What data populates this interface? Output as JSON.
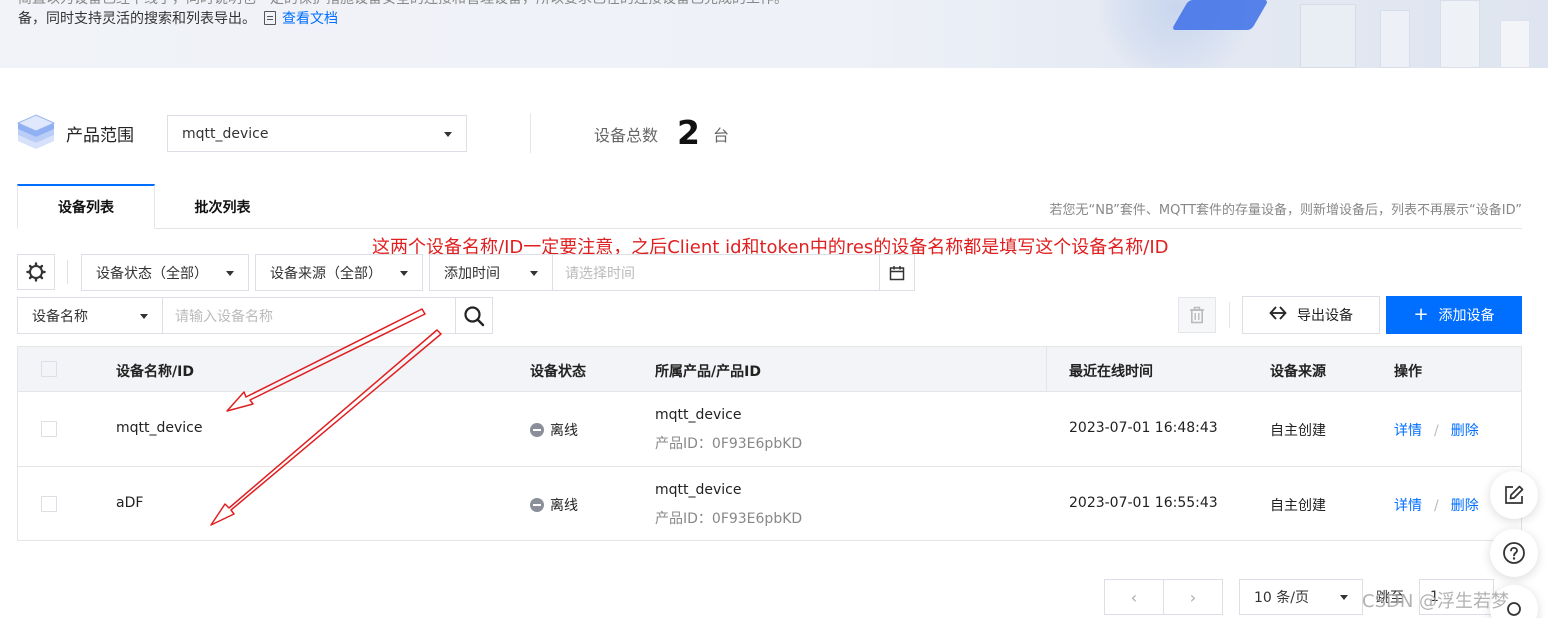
{
  "banner": {
    "cut_text": "简直以为设备已经下线了，同时说明也一定的保护措施设备安全的连接和管理设备，所以要求已在的连接设备已完成的工作。",
    "text": "备，同时支持灵活的搜索和列表导出。",
    "doc_link": "查看文档"
  },
  "product": {
    "label": "产品范围",
    "selected": "mqtt_device"
  },
  "summary": {
    "label": "设备总数",
    "count": "2",
    "unit": "台"
  },
  "tabs": [
    {
      "label": "设备列表",
      "active": true
    },
    {
      "label": "批次列表",
      "active": false
    }
  ],
  "tabs_hint": "若您无“NB”套件、MQTT套件的存量设备，则新增设备后，列表不再展示“设备ID”",
  "annotation": "这两个设备名称/ID一定要注意，之后Client id和token中的res的设备名称都是填写这个设备名称/ID",
  "filters": {
    "status": "设备状态（全部）",
    "source": "设备来源（全部）",
    "time_type": "添加时间",
    "time_placeholder": "请选择时间",
    "search_field": "设备名称",
    "search_placeholder": "请输入设备名称"
  },
  "actions": {
    "export": "导出设备",
    "add": "添加设备"
  },
  "table": {
    "headers": [
      "设备名称/ID",
      "设备状态",
      "所属产品/产品ID",
      "最近在线时间",
      "设备来源",
      "操作"
    ],
    "rows": [
      {
        "name": "mqtt_device",
        "status": "离线",
        "product": "mqtt_device",
        "product_id": "产品ID：0F93E6pbKD",
        "last_online": "2023-07-01 16:48:43",
        "source": "自主创建",
        "op_detail": "详情",
        "op_delete": "删除"
      },
      {
        "name": "aDF",
        "status": "离线",
        "product": "mqtt_device",
        "product_id": "产品ID：0F93E6pbKD",
        "last_online": "2023-07-01 16:55:43",
        "source": "自主创建",
        "op_detail": "详情",
        "op_delete": "删除"
      }
    ]
  },
  "pagination": {
    "page_size": "10 条/页",
    "jump_label": "跳至",
    "page_input": "1"
  },
  "watermark": "CSDN @浮生若梦",
  "colors": {
    "accent": "#006eff",
    "annotation": "#e02020"
  }
}
